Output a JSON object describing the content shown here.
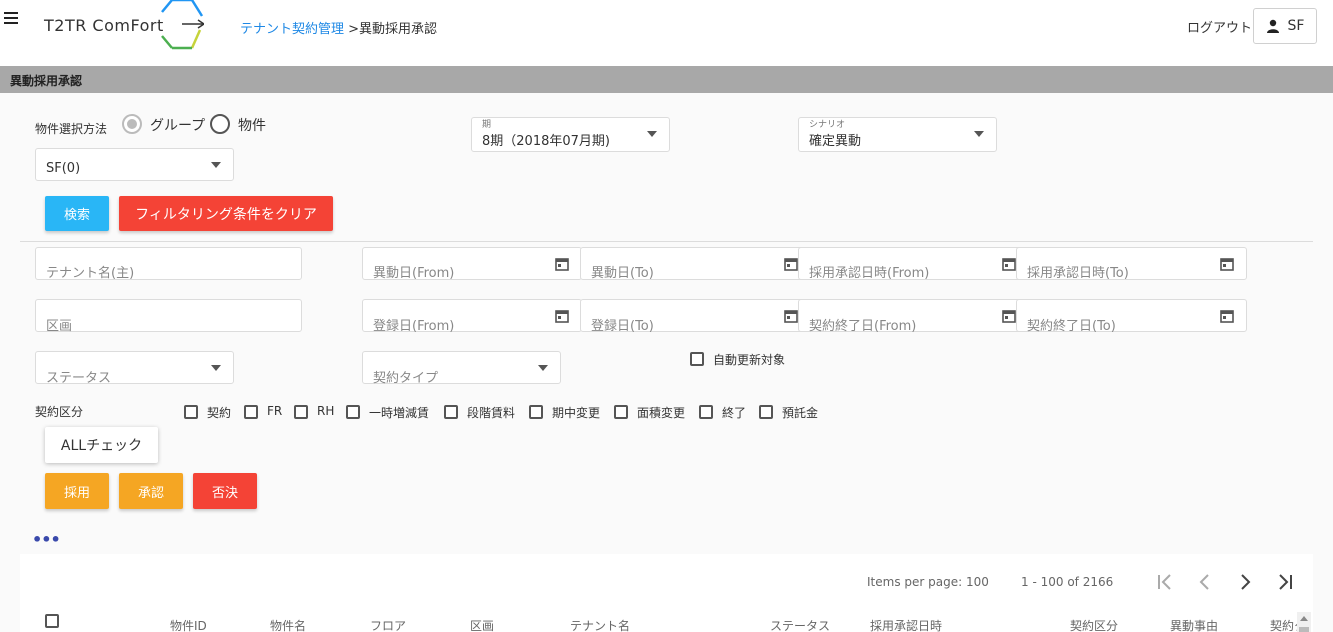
{
  "header": {
    "logo_text": "T2TR ComFort",
    "breadcrumb_link": "テナント契約管理",
    "breadcrumb_sep": " >",
    "breadcrumb_current": "異動採用承認",
    "logout_label": "ログアウト",
    "user_label": "SF"
  },
  "title": "異動採用承認",
  "selection": {
    "label": "物件選択方法",
    "options": [
      "グループ",
      "物件"
    ],
    "selected": "グループ",
    "group_select_value": "SF(0)"
  },
  "period": {
    "label": "期",
    "value": "8期（2018年07月期)"
  },
  "scenario": {
    "label": "シナリオ",
    "value": "確定異動"
  },
  "buttons": {
    "search": "検索",
    "clear_filter": "フィルタリング条件をクリア",
    "all_check": "ALLチェック",
    "adopt": "採用",
    "approve": "承認",
    "reject": "否決"
  },
  "filters": {
    "tenant_name": "テナント名(主)",
    "change_from": "異動日(From)",
    "change_to": "異動日(To)",
    "approval_from": "採用承認日時(From)",
    "approval_to": "採用承認日時(To)",
    "section": "区画",
    "register_from": "登録日(From)",
    "register_to": "登録日(To)",
    "contract_end_from": "契約終了日(From)",
    "contract_end_to": "契約終了日(To)",
    "status": "ステータス",
    "contract_type": "契約タイプ",
    "auto_renew": "自動更新対象"
  },
  "contract_class": {
    "label": "契約区分",
    "options": [
      "契約",
      "FR",
      "RH",
      "一時増減賃",
      "段階賃料",
      "期中変更",
      "面積変更",
      "終了",
      "預託金"
    ]
  },
  "more": "•••",
  "paginator": {
    "items_per_page": "Items per page: 100",
    "range": "1 - 100 of 2166"
  },
  "table": {
    "columns": [
      "物件ID",
      "物件名",
      "フロア",
      "区画",
      "テナント名",
      "ステータス",
      "採用承認日時",
      "契約区分",
      "異動事由",
      "契約タ"
    ]
  }
}
